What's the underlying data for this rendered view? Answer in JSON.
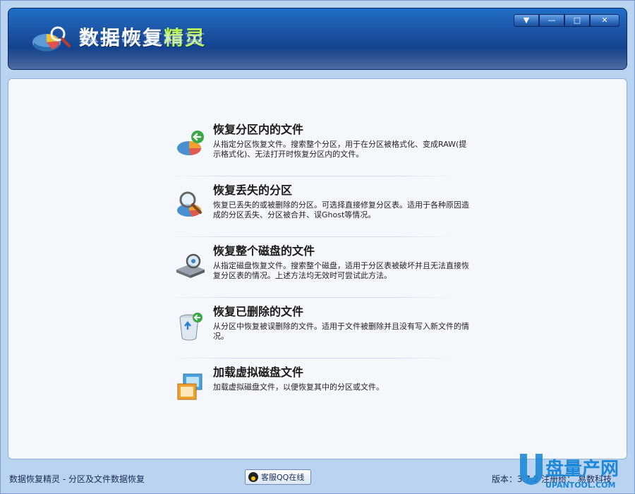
{
  "app": {
    "title_main": "数据恢复",
    "title_accent": "精灵"
  },
  "window_controls": [
    {
      "name": "menu-button",
      "glyph": "▼"
    },
    {
      "name": "minimize-button",
      "glyph": "—"
    },
    {
      "name": "maximize-button",
      "glyph": "□"
    },
    {
      "name": "close-button",
      "glyph": "✕"
    }
  ],
  "options": [
    {
      "title": "恢复分区内的文件",
      "desc": "从指定分区恢复文件。搜索整个分区，用于在分区被格式化、变成RAW(提示格式化)、无法打开时恢复分区内的文件。",
      "icon": "partition-recover-icon"
    },
    {
      "title": "恢复丢失的分区",
      "desc": "恢复已丢失的或被删除的分区。可选择直接修复分区表。适用于各种原因造成的分区丢失、分区被合并、误Ghost等情况。",
      "icon": "lost-partition-icon"
    },
    {
      "title": "恢复整个磁盘的文件",
      "desc": "从指定磁盘恢复文件。搜索整个磁盘，适用于分区表被破坏并且无法直接恢复分区表的情况。上述方法均无效时可尝试此方法。",
      "icon": "disk-recover-icon"
    },
    {
      "title": "恢复已删除的文件",
      "desc": "从分区中恢复被误删除的文件。适用于文件被删除并且没有写入新文件的情况。",
      "icon": "recycle-bin-icon"
    },
    {
      "title": "加载虚拟磁盘文件",
      "desc": "加载虚拟磁盘文件，以便恢复其中的分区或文件。",
      "icon": "virtual-disk-icon"
    }
  ],
  "status": {
    "left": "数据恢复精灵 - 分区及文件数据恢复",
    "qq_label": "客服QQ在线",
    "right": "版本：3.7.2  注册给：  易数科技"
  },
  "watermark": {
    "text": "盘量产网",
    "sub": "UPANTOOL.COM"
  },
  "colors": {
    "title_accent": "#b8f55a",
    "titlebar": "#1a4f9e",
    "content_bg": "#f4f8fd"
  }
}
